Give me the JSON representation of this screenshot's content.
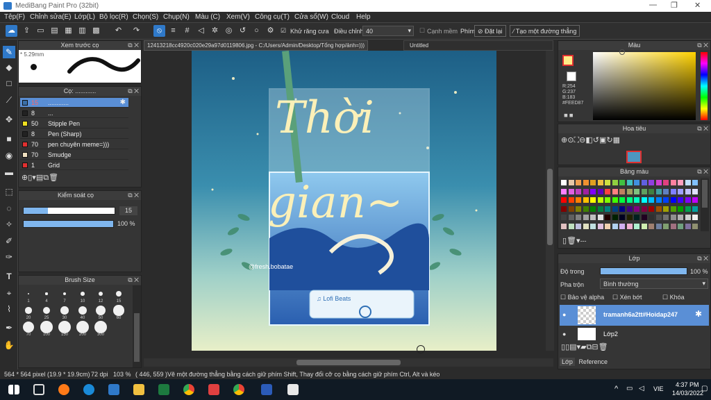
{
  "window": {
    "title": "MediBang Paint Pro (32bit)",
    "minimize": "—",
    "restore": "❐",
    "close": "✕"
  },
  "menu": [
    "Tệp(F)",
    "Chỉnh sửa(E)",
    "Lớp(L)",
    "Bộ lọc(R)",
    "Chọn(S)",
    "Chụp(N)",
    "Màu (C)",
    "Xem(V)",
    "Công cụ(T)",
    "Cửa sổ(W)",
    "Cloud",
    "Help"
  ],
  "toolbar": {
    "antialias_label": "Khử răng cưa",
    "correction_label": "Điều chỉnh",
    "correction_value": "40",
    "soft_edge_label": "Cạnh mềm",
    "brush_label": "Phím",
    "reset_label": "Đặt lại",
    "straight_line_label": "Tạo một đường thẳng"
  },
  "brush_preview": {
    "title": "Xem trước cọ",
    "size": "5.29mm"
  },
  "brush_list": {
    "title": "Cọ: ............",
    "items": [
      {
        "size": "15",
        "name": "............",
        "color": "#3a6fa8",
        "selected": true
      },
      {
        "size": "8",
        "name": "...",
        "color": "#222222",
        "selected": false
      },
      {
        "size": "50",
        "name": "Stipple Pen",
        "color": "#f0e020",
        "selected": false
      },
      {
        "size": "8",
        "name": "Pen (Sharp)",
        "color": "#222222",
        "selected": false
      },
      {
        "size": "70",
        "name": "pen chuyên meme=)))",
        "color": "#e03030",
        "selected": false
      },
      {
        "size": "70",
        "name": "Smudge",
        "color": "#f0e0c0",
        "selected": false
      },
      {
        "size": "1",
        "name": "Grid",
        "color": "#e03030",
        "selected": false
      }
    ]
  },
  "brush_control": {
    "title": "Kiểm soát cọ",
    "size_value": "15",
    "opacity_value": "100 %",
    "size_fraction": 0.27,
    "opacity_fraction": 1.0
  },
  "brush_size": {
    "title": "Brush Size",
    "labels": [
      "1",
      "4",
      "7",
      "10",
      "12",
      "15",
      "20",
      "25",
      "30",
      "40",
      "50",
      "60",
      "70",
      "100",
      "150",
      "200",
      "300"
    ]
  },
  "canvas": {
    "tab1": "12413218cc4920c020e29a97d0119806.jpg - C:/Users/Admin/Desktop/Tổng hợp/ảnh=)))",
    "tab2": "Untitled",
    "art_title_line1": "Thời",
    "art_title_line2": "gian~",
    "watermark": "@fresh.bobatae",
    "player_label": "♫ Lofi Beats"
  },
  "color_panel": {
    "title": "Màu",
    "r": "R:254",
    "g": "G:237",
    "b": "B:183",
    "hex": "#FEED87"
  },
  "navigator": {
    "title": "Hoa tiêu"
  },
  "palette": {
    "title": "Bảng màu",
    "dots": "---"
  },
  "layer_panel": {
    "title": "Lớp",
    "opacity_label": "Độ trong",
    "opacity_value": "100 %",
    "opacity_fraction": 1.0,
    "blend_label": "Pha trộn",
    "blend_value": "Bình thường",
    "protect_alpha": "Bảo vệ alpha",
    "clipping": "Xén bớt",
    "lock": "Khóa",
    "layers": [
      "tramanh6a2tt#Hoidap247",
      "Lớp2"
    ],
    "tab_layer": "Lớp",
    "tab_reference": "Reference"
  },
  "status": {
    "size": "564 * 564 pixel",
    "dims": "(19.9 * 19.9cm)",
    "dpi": "72 dpi",
    "zoom": "103 %",
    "coords": "( 446, 559 )",
    "hint": "Vẽ một đường thẳng bằng cách giữ phím Shift, Thay đổi cỡ cọ bằng cách giữ phím Ctrl, Alt và kéo"
  },
  "taskbar": {
    "lang": "VIE",
    "time": "4:37 PM",
    "date": "14/03/2022"
  }
}
